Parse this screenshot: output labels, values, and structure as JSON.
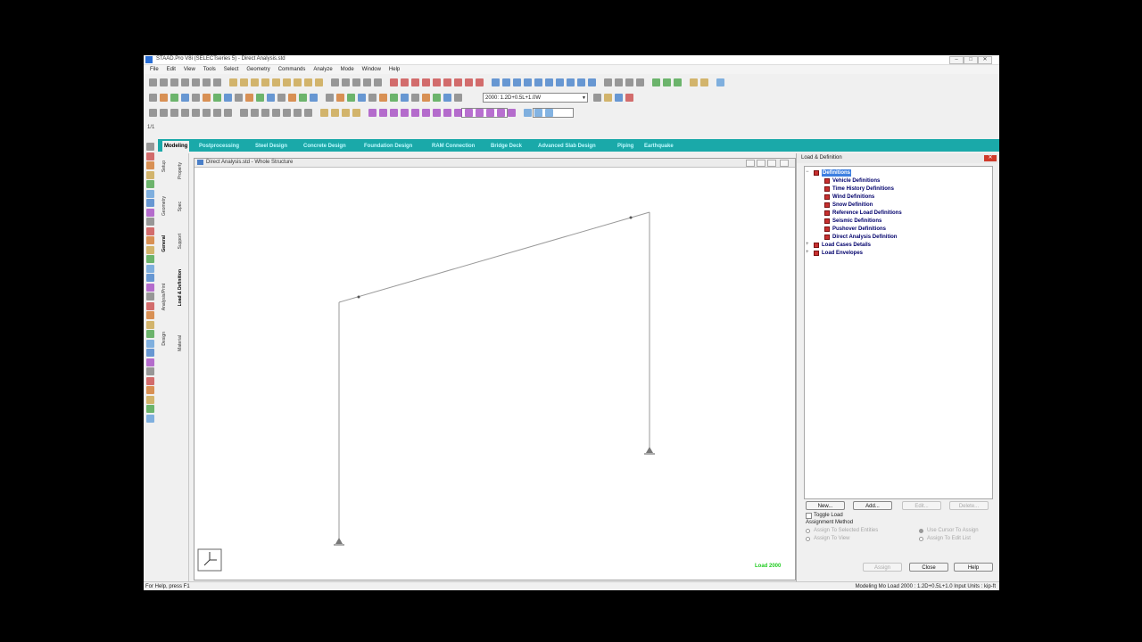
{
  "window": {
    "title": "STAAD.Pro V8i (SELECTseries 5) - Direct Analysis.std",
    "controls": [
      "–",
      "□",
      "✕"
    ]
  },
  "menu": [
    "File",
    "Edit",
    "View",
    "Tools",
    "Select",
    "Geometry",
    "Commands",
    "Analyze",
    "Mode",
    "Window",
    "Help"
  ],
  "toolbar": {
    "load_case_combo": "2000: 1.2D+0.5L+1.0W",
    "small_label": "1/1"
  },
  "workflow_tabs": [
    {
      "label": "Modeling",
      "active": true
    },
    {
      "label": "Postprocessing"
    },
    {
      "label": "Steel Design"
    },
    {
      "label": "Concrete Design"
    },
    {
      "label": "Foundation Design"
    },
    {
      "label": "RAM Connection"
    },
    {
      "label": "Bridge Deck"
    },
    {
      "label": "Advanced Slab Design"
    },
    {
      "label": "Piping"
    },
    {
      "label": "Earthquake"
    }
  ],
  "page_control": {
    "outer": [
      "Setup",
      "Geometry",
      "General",
      "Analysis/Print",
      "Design"
    ],
    "inner": [
      "Property",
      "Spec",
      "Support",
      "Load & Definition",
      "Material"
    ],
    "active_inner": "Load & Definition"
  },
  "view_window": {
    "title": "Direct Analysis.std - Whole Structure",
    "load_label": "Load 2000",
    "load_color": "#22cc22"
  },
  "panel": {
    "title": "Load & Definition",
    "tree": {
      "root": "Definitions",
      "children": [
        "Vehicle Definitions",
        "Time History Definitions",
        "Wind Definitions",
        "Snow Definition",
        "Reference Load Definitions",
        "Seismic Definitions",
        "Pushover Definitions",
        "Direct Analysis Definition"
      ],
      "siblings": [
        "Load Cases Details",
        "Load Envelopes"
      ]
    },
    "buttons": {
      "new": "New...",
      "add": "Add...",
      "edit": "Edit...",
      "delete": "Delete...",
      "assign": "Assign",
      "close": "Close",
      "help": "Help"
    },
    "toggle_load": "Toggle Load",
    "assignment_method": "Assignment Method",
    "opt_selected": "Assign To Selected Entities",
    "opt_view": "Assign To View",
    "opt_cursor": "Use Cursor To Assign",
    "opt_edit": "Assign To Edit List"
  },
  "status": {
    "left": "For Help, press F1",
    "right": "Modeling Mo Load 2000 : 1.2D+0.5L+1.0 Input Units : kip-ft"
  }
}
